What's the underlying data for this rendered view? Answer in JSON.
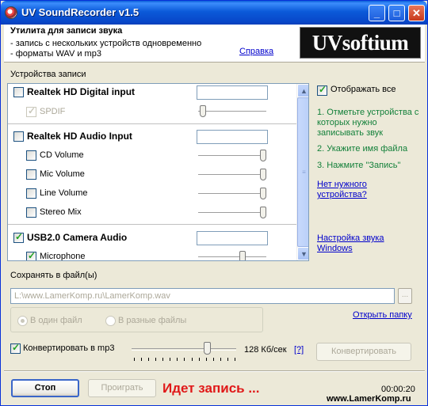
{
  "window": {
    "title": "UV SoundRecorder v1.5",
    "buttons": {
      "minimize": "_",
      "maximize": "□",
      "close": "✕"
    }
  },
  "header": {
    "title": "Утилита для записи звука",
    "line1": "- запись с нескольких устройств одновременно",
    "line2": "- форматы WAV и mp3",
    "help_link": "Справка",
    "logo": "UVsoftium"
  },
  "devices_section": {
    "label": "Устройства записи",
    "devices": [
      {
        "name": "Realtek HD Digital input",
        "checked": false,
        "inputs": [
          {
            "name": "SPDIF",
            "checked": true,
            "disabled": true,
            "level": 0.0
          }
        ]
      },
      {
        "name": "Realtek HD Audio Input",
        "checked": false,
        "inputs": [
          {
            "name": "CD Volume",
            "checked": false,
            "level": 1.0
          },
          {
            "name": "Mic Volume",
            "checked": false,
            "level": 1.0
          },
          {
            "name": "Line Volume",
            "checked": false,
            "level": 1.0
          },
          {
            "name": "Stereo Mix",
            "checked": false,
            "level": 1.0
          }
        ]
      },
      {
        "name": "USB2.0 Camera Audio",
        "checked": true,
        "input_level": 0.08,
        "inputs": [
          {
            "name": "Microphone",
            "checked": true,
            "level": 0.66
          }
        ]
      }
    ],
    "scroll_up": "▲",
    "scroll_down": "▼",
    "scroll_grip": "≡"
  },
  "right_panel": {
    "show_all_label": "Отображать все",
    "show_all_checked": true,
    "step1": "1. Отметьте устройства с которых нужно записывать звук",
    "step2": "2. Укажите имя файла",
    "step3": "3. Нажмите \"Запись\"",
    "no_device_link": "Нет нужного устройства?",
    "sound_settings_link": "Настройка звука Windows"
  },
  "save_section": {
    "label": "Сохранять в файл(ы)",
    "path": "L:\\www.LamerKomp.ru\\LamerKomp.wav",
    "browse_label": "...",
    "mode_single": "В один файл",
    "mode_separate": "В разные файлы",
    "mode_selected": "single",
    "open_folder_link": "Открыть папку"
  },
  "convert": {
    "label": "Конвертировать в mp3",
    "checked": true,
    "bitrate": "128 Кб/сек",
    "bitrate_position": 0.72,
    "help_link": "[?]",
    "button": "Конвертировать"
  },
  "footer": {
    "stop_button": "Стоп",
    "play_button": "Проиграть",
    "status": "Идет запись ...",
    "timer": "00:00:20",
    "site": "www.LamerKomp.ru"
  },
  "colors": {
    "title_bar": "#0a5fd8",
    "status": "#e01818",
    "steps": "#13803a",
    "link": "#0000cc"
  }
}
